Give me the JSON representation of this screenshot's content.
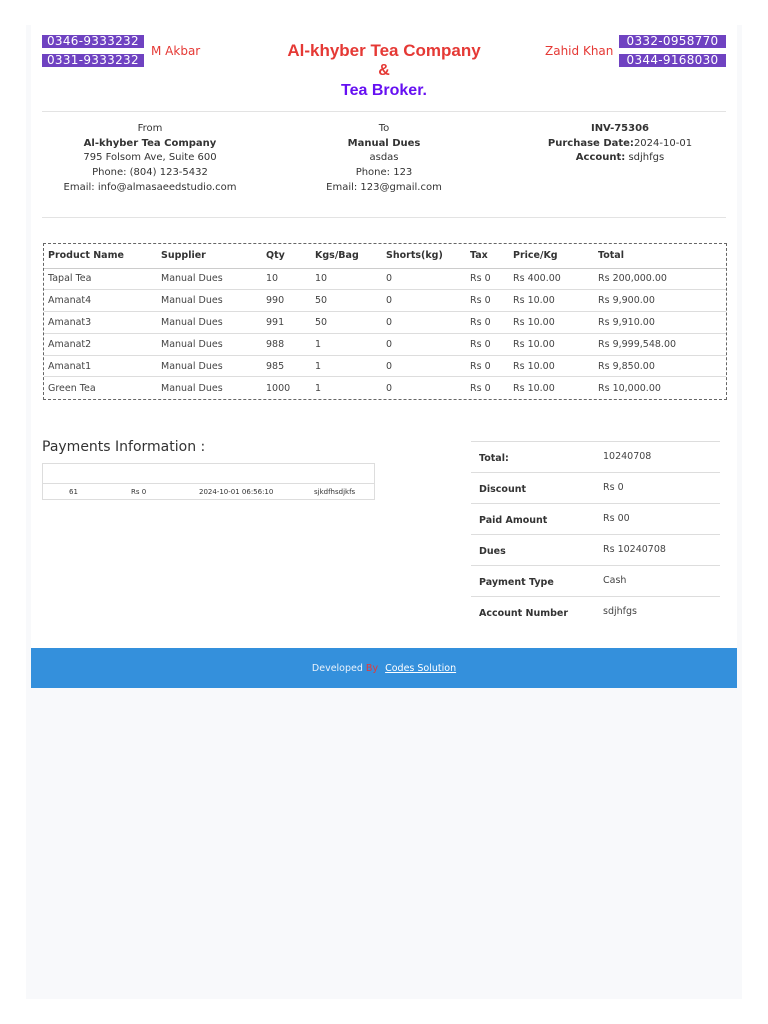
{
  "header": {
    "phones_left": [
      "0346-9333232",
      "0331-9333232"
    ],
    "name_left": "M Akbar",
    "title1": "Al-khyber Tea Company",
    "amp": "&",
    "title2": "Tea Broker.",
    "name_right": "Zahid Khan",
    "phones_right": [
      "0332-0958770",
      "0344-9168030"
    ]
  },
  "from": {
    "label": "From",
    "name": "Al-khyber Tea Company",
    "address": "795 Folsom Ave, Suite 600",
    "phone": "Phone: (804) 123-5432",
    "email": "Email: info@almasaeedstudio.com"
  },
  "to": {
    "label": "To",
    "name": "Manual Dues",
    "address": "asdas",
    "phone": "Phone: 123",
    "email": "Email: 123@gmail.com"
  },
  "invoice": {
    "number": "INV-75306",
    "date_label": "Purchase Date:",
    "date": "2024-10-01",
    "account_label": "Account:",
    "account": "sdjhfgs"
  },
  "table": {
    "headers": [
      "Product Name",
      "Supplier",
      "Qty",
      "Kgs/Bag",
      "Shorts(kg)",
      "Tax",
      "Price/Kg",
      "Total"
    ],
    "rows": [
      [
        "Tapal Tea",
        "Manual Dues",
        "10",
        "10",
        "0",
        "Rs 0",
        "Rs 400.00",
        "Rs 200,000.00"
      ],
      [
        "Amanat4",
        "Manual Dues",
        "990",
        "50",
        "0",
        "Rs 0",
        "Rs 10.00",
        "Rs 9,900.00"
      ],
      [
        "Amanat3",
        "Manual Dues",
        "991",
        "50",
        "0",
        "Rs 0",
        "Rs 10.00",
        "Rs 9,910.00"
      ],
      [
        "Amanat2",
        "Manual Dues",
        "988",
        "1",
        "0",
        "Rs 0",
        "Rs 10.00",
        "Rs 9,999,548.00"
      ],
      [
        "Amanat1",
        "Manual Dues",
        "985",
        "1",
        "0",
        "Rs 0",
        "Rs 10.00",
        "Rs 9,850.00"
      ],
      [
        "Green Tea",
        "Manual Dues",
        "1000",
        "1",
        "0",
        "Rs 0",
        "Rs 10.00",
        "Rs 10,000.00"
      ]
    ]
  },
  "payments": {
    "title": "Payments Information :",
    "row": [
      "61",
      "Rs 0",
      "2024-10-01 06:56:10",
      "sjkdfhsdjkfs"
    ]
  },
  "summary": [
    [
      "Total:",
      "10240708"
    ],
    [
      "Discount",
      "Rs 0"
    ],
    [
      "Paid Amount",
      "Rs 00"
    ],
    [
      "Dues",
      "Rs 10240708"
    ],
    [
      "Payment Type",
      "Cash"
    ],
    [
      "Account Number",
      "sdjhfgs"
    ]
  ],
  "footer": {
    "developed": "Developed",
    "by": "By",
    "link": "Codes Solution"
  }
}
